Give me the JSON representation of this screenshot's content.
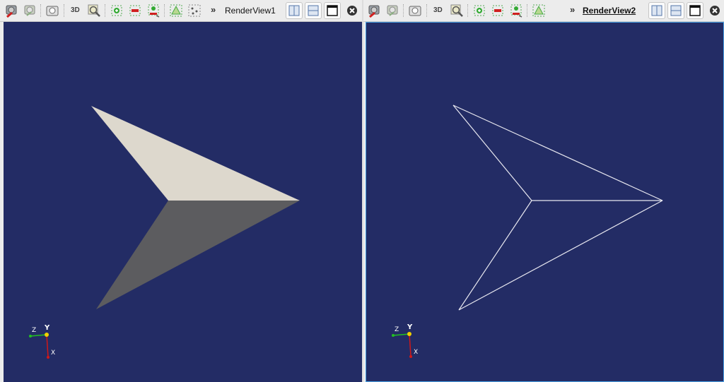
{
  "toolbar": {
    "mode_3d_label": "3D",
    "overflow_glyph": "»"
  },
  "views": [
    {
      "name": "RenderView1",
      "active": false,
      "representation": "Surface"
    },
    {
      "name": "RenderView2",
      "active": true,
      "representation": "Wireframe"
    }
  ],
  "orientation_axes": {
    "y_label": "Y",
    "z_label": "Z",
    "x_label": "X"
  },
  "colors": {
    "background": "#232c65",
    "surface_light": "#ddd8cd",
    "surface_dark": "#5c5c5f",
    "wireframe": "#e8e8f0",
    "active_border": "#4aa3e6",
    "axis_y": "#f0d000",
    "axis_z": "#22c022",
    "axis_x": "#d01818"
  },
  "icons": [
    "reset-camera-icon",
    "reset-camera-closest-icon",
    "capture-screenshot-icon",
    "zoom-to-data-icon",
    "rotate-plus-x-icon",
    "rotate-minus-x-icon",
    "zoom-to-box-icon",
    "interactive-select-icon",
    "select-points-icon",
    "split-horizontal-icon",
    "split-vertical-icon",
    "maximize-icon",
    "close-icon"
  ]
}
